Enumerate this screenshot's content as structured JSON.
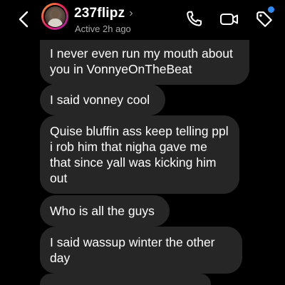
{
  "header": {
    "back_label": "back",
    "contact_name": "237flipz",
    "chevron": "›",
    "status": "Active 2h ago",
    "icons": [
      "back-arrow-icon",
      "phone-icon",
      "video-camera-icon",
      "tag-icon"
    ],
    "notification_dot_color": "#2f8cf5"
  },
  "messages": [
    {
      "text": "I never even run my mouth about you in VonnyeOnTheBeat"
    },
    {
      "text": "I said vonney cool"
    },
    {
      "text": "Quise bluffin ass keep telling ppl i rob him that nigha gave me that since yall was kicking him out"
    },
    {
      "text": "Who is all the guys"
    },
    {
      "text": "I said wassup winter the other day"
    }
  ],
  "colors": {
    "background": "#000000",
    "bubble": "#262626",
    "text": "#ffffff",
    "muted": "#a8a8a8"
  }
}
